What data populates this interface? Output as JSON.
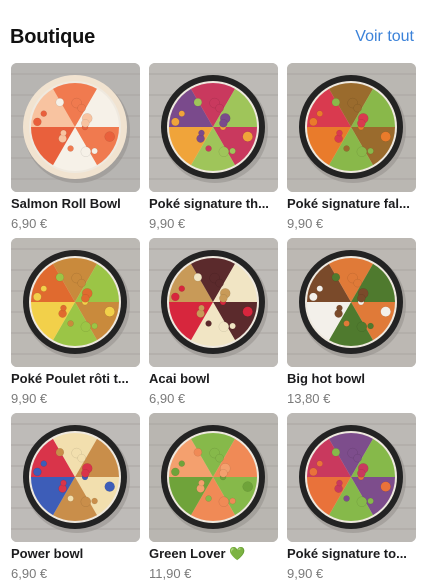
{
  "header": {
    "title": "Boutique",
    "see_all": "Voir tout"
  },
  "products": [
    {
      "name": "Salmon Roll Bowl",
      "price": "6,90 €",
      "palette": {
        "bowl": "#f1e3d0",
        "toppings": [
          "#f07a4f",
          "#f6f1e8",
          "#e9603c",
          "#f8c3a0"
        ],
        "bg": "#b7b5b2"
      }
    },
    {
      "name": "Poké signature th...",
      "price": "9,90 €",
      "palette": {
        "bowl": "#232323",
        "toppings": [
          "#c9395e",
          "#9fc55a",
          "#f0a43a",
          "#7a4a8c"
        ],
        "bg": "#bdbab6"
      }
    },
    {
      "name": "Poké signature fal...",
      "price": "9,90 €",
      "palette": {
        "bowl": "#232323",
        "toppings": [
          "#9a6b2d",
          "#89b84a",
          "#e97b2b",
          "#d93a4f"
        ],
        "bg": "#bab7b2"
      }
    },
    {
      "name": "Poké Poulet rôti t...",
      "price": "9,90 €",
      "palette": {
        "bowl": "#232323",
        "toppings": [
          "#c98a3c",
          "#9bc546",
          "#f2d04a",
          "#e06a2f"
        ],
        "bg": "#bcb9b4"
      }
    },
    {
      "name": "Acai bowl",
      "price": "6,90 €",
      "palette": {
        "bowl": "#232323",
        "toppings": [
          "#5b2a2c",
          "#f1e5c4",
          "#d7263d",
          "#c89a58"
        ],
        "bg": "#bebbb7"
      }
    },
    {
      "name": "Big hot bowl",
      "price": "13,80 €",
      "palette": {
        "bowl": "#232323",
        "toppings": [
          "#e07a38",
          "#4f7a2e",
          "#f3f0ea",
          "#7a4a2a"
        ],
        "bg": "#bcb8b3"
      }
    },
    {
      "name": "Power bowl",
      "price": "6,90 €",
      "palette": {
        "bowl": "#232323",
        "toppings": [
          "#f2dfae",
          "#c98e4a",
          "#3d5db8",
          "#d9344a"
        ],
        "bg": "#bebbb8"
      }
    },
    {
      "name": "Green Lover",
      "price": "11,90 €",
      "heart": "💚",
      "palette": {
        "bowl": "#232323",
        "toppings": [
          "#86b94a",
          "#f08a56",
          "#6fa33a",
          "#f4a06e"
        ],
        "bg": "#b9b6b1"
      }
    },
    {
      "name": "Poké signature to...",
      "price": "9,90 €",
      "palette": {
        "bowl": "#232323",
        "toppings": [
          "#7d4d8c",
          "#86b94a",
          "#e9723a",
          "#c9395e"
        ],
        "bg": "#bcb9b5"
      }
    }
  ]
}
